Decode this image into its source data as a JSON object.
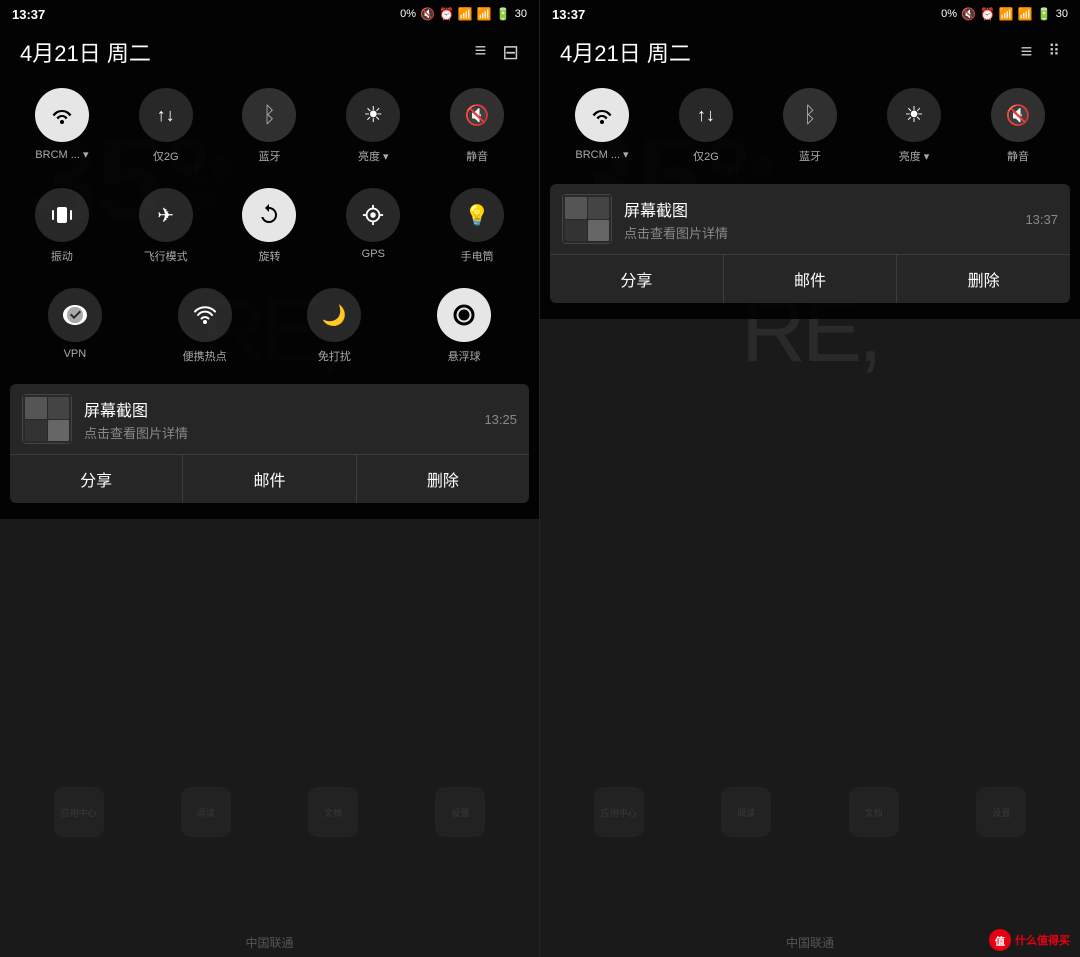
{
  "left_panel": {
    "status": {
      "time": "13:37",
      "battery_pct": "0%",
      "signal_bars": "▂▄▆",
      "battery_icon": "▭"
    },
    "header": {
      "date": "4月21日 周二",
      "icon_list": "≡",
      "icon_grid": "⊟"
    },
    "toggles_row1": [
      {
        "id": "wifi",
        "label": "BRCM ...",
        "label_suffix": "▾",
        "active": true
      },
      {
        "id": "data",
        "label": "仅2G",
        "active": false
      },
      {
        "id": "bluetooth",
        "label": "蓝牙",
        "active": false,
        "dark": true
      },
      {
        "id": "brightness",
        "label": "亮度",
        "label_suffix": "▾",
        "active": false
      },
      {
        "id": "mute",
        "label": "静音",
        "active": false,
        "dark": true
      }
    ],
    "toggles_row2": [
      {
        "id": "vibrate",
        "label": "振动"
      },
      {
        "id": "airplane",
        "label": "飞行模式"
      },
      {
        "id": "rotate",
        "label": "旋转",
        "active": true
      },
      {
        "id": "gps",
        "label": "GPS"
      },
      {
        "id": "flashlight",
        "label": "手电筒"
      }
    ],
    "toggles_row3": [
      {
        "id": "vpn",
        "label": "VPN"
      },
      {
        "id": "hotspot",
        "label": "便携热点"
      },
      {
        "id": "dnd",
        "label": "免打扰"
      },
      {
        "id": "float",
        "label": "悬浮球",
        "active": true
      }
    ],
    "notification": {
      "thumb_alt": "截图预览",
      "title": "屏幕截图",
      "desc": "点击查看图片详情",
      "time": "13:25",
      "actions": [
        "分享",
        "邮件",
        "删除"
      ]
    },
    "carrier": "中国联通"
  },
  "right_panel": {
    "status": {
      "time": "13:37",
      "battery_pct": "0%"
    },
    "header": {
      "date": "4月21日 周二",
      "icon_list": "≡",
      "icon_dots": "⠿"
    },
    "toggles_row1": [
      {
        "id": "wifi",
        "label": "BRCM ...",
        "label_suffix": "▾",
        "active": true
      },
      {
        "id": "data",
        "label": "仅2G",
        "active": false
      },
      {
        "id": "bluetooth",
        "label": "蓝牙",
        "active": false,
        "dark": true
      },
      {
        "id": "brightness",
        "label": "亮度",
        "label_suffix": "▾",
        "active": false
      },
      {
        "id": "mute",
        "label": "静音",
        "active": false,
        "dark": true
      }
    ],
    "notification": {
      "thumb_alt": "截图预览",
      "title": "屏幕截图",
      "desc": "点击查看图片详情",
      "time": "13:37",
      "actions": [
        "分享",
        "邮件",
        "删除"
      ]
    },
    "carrier": "中国联通",
    "watermark": {
      "icon": "值",
      "text": "什么值得买"
    }
  },
  "icons": {
    "wifi": "📶",
    "data": "↑↓",
    "bluetooth": "ᛒ",
    "brightness": "☀",
    "mute": "🔇",
    "vibrate": "📳",
    "airplane": "✈",
    "rotate": "⟳",
    "gps": "◎",
    "flashlight": "💡",
    "vpn": "☁",
    "hotspot": "📡",
    "dnd": "🌙",
    "float": "⊙"
  }
}
